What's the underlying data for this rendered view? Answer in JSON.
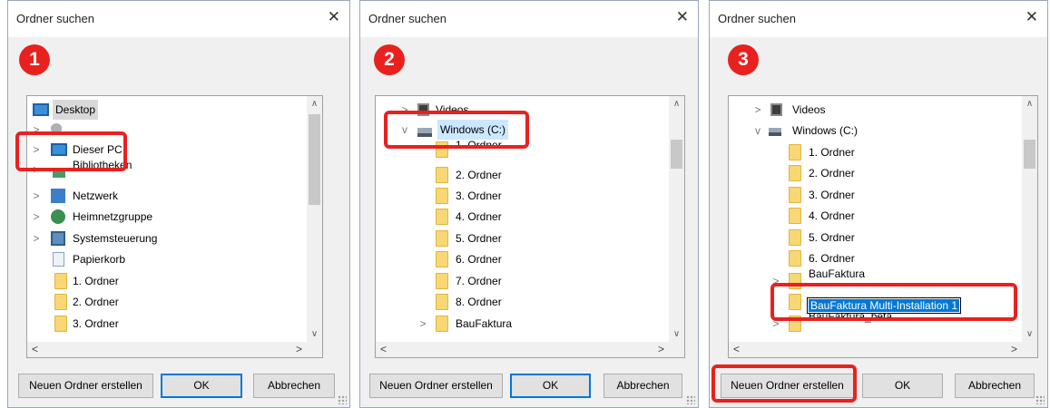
{
  "dialog_title": "Ordner suchen",
  "close_glyph": "✕",
  "buttons": {
    "new_folder": "Neuen Ordner erstellen",
    "ok": "OK",
    "cancel": "Abbrechen"
  },
  "panels": [
    {
      "step": "1",
      "highlighted_item": "Dieser PC",
      "items": [
        {
          "label": "Desktop",
          "icon": "desktop-icon",
          "expander": "",
          "selected": true
        },
        {
          "label": "",
          "icon": "user-icon",
          "expander": ">"
        },
        {
          "label": "Dieser PC",
          "icon": "this-pc-icon",
          "expander": ">"
        },
        {
          "label": "Bibliotheken",
          "icon": "libraries-icon",
          "expander": ">"
        },
        {
          "label": "Netzwerk",
          "icon": "network-icon",
          "expander": ">"
        },
        {
          "label": "Heimnetzgruppe",
          "icon": "homegroup-icon",
          "expander": ">"
        },
        {
          "label": "Systemsteuerung",
          "icon": "control-panel-icon",
          "expander": ">"
        },
        {
          "label": "Papierkorb",
          "icon": "recycle-bin-icon",
          "expander": ""
        },
        {
          "label": "1. Ordner",
          "icon": "folder-icon",
          "expander": ""
        },
        {
          "label": "2. Ordner",
          "icon": "folder-icon",
          "expander": ""
        },
        {
          "label": "3. Ordner",
          "icon": "folder-icon",
          "expander": ""
        }
      ]
    },
    {
      "step": "2",
      "highlighted_item": "Windows (C:)",
      "items": [
        {
          "label": "Videos",
          "icon": "videos-icon",
          "expander": ">"
        },
        {
          "label": "Windows (C:)",
          "icon": "drive-icon",
          "expander": "v",
          "selected": true
        },
        {
          "label": "1. Ordner",
          "icon": "folder-icon",
          "expander": ""
        },
        {
          "label": "2. Ordner",
          "icon": "folder-icon",
          "expander": ""
        },
        {
          "label": "3. Ordner",
          "icon": "folder-icon",
          "expander": ""
        },
        {
          "label": "4. Ordner",
          "icon": "folder-icon",
          "expander": ""
        },
        {
          "label": "5. Ordner",
          "icon": "folder-icon",
          "expander": ""
        },
        {
          "label": "6. Ordner",
          "icon": "folder-icon",
          "expander": ""
        },
        {
          "label": "7. Ordner",
          "icon": "folder-icon",
          "expander": ""
        },
        {
          "label": "8. Ordner",
          "icon": "folder-icon",
          "expander": ""
        },
        {
          "label": "BauFaktura",
          "icon": "folder-icon",
          "expander": ">"
        }
      ]
    },
    {
      "step": "3",
      "highlighted_item": "BauFaktura Multi-Installation 1",
      "new_folder_edit_value": "BauFaktura Multi-Installation 1",
      "items": [
        {
          "label": "Videos",
          "icon": "videos-icon",
          "expander": ">"
        },
        {
          "label": "Windows (C:)",
          "icon": "drive-icon",
          "expander": "v"
        },
        {
          "label": "1. Ordner",
          "icon": "folder-icon",
          "expander": ""
        },
        {
          "label": "2. Ordner",
          "icon": "folder-icon",
          "expander": ""
        },
        {
          "label": "3. Ordner",
          "icon": "folder-icon",
          "expander": ""
        },
        {
          "label": "4. Ordner",
          "icon": "folder-icon",
          "expander": ""
        },
        {
          "label": "5. Ordner",
          "icon": "folder-icon",
          "expander": ""
        },
        {
          "label": "6. Ordner",
          "icon": "folder-icon",
          "expander": ""
        },
        {
          "label": "BauFaktura",
          "icon": "folder-icon",
          "expander": ">"
        },
        {
          "label": "",
          "icon": "folder-icon",
          "expander": ""
        },
        {
          "label": "BauFaktura_beta",
          "icon": "folder-icon",
          "expander": ">"
        }
      ]
    }
  ],
  "colors": {
    "highlight_red": "#e8211f",
    "selection_blue": "#cce8ff",
    "edit_selection": "#0078d7",
    "folder_yellow": "#f8d775"
  }
}
